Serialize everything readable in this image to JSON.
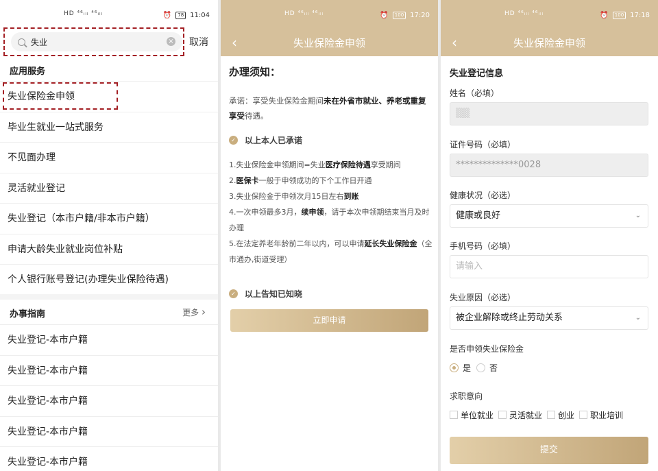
{
  "screen1": {
    "status": {
      "signal": "HD ⁴⁶ᵢₗₗ ⁴⁶ᵢₗₗ",
      "battery": "78",
      "time": "11:04"
    },
    "search": {
      "value": "失业",
      "cancel": "取消"
    },
    "services_title": "应用服务",
    "services": [
      "失业保险金申领",
      "毕业生就业一站式服务",
      "不见面办理",
      "灵活就业登记",
      "失业登记（本市户籍/非本市户籍）",
      "申请大龄失业就业岗位补贴",
      "个人银行账号登记(办理失业保险待遇)"
    ],
    "guide_title": "办事指南",
    "more": "更多",
    "guides": [
      "失业登记-本市户籍",
      "失业登记-本市户籍",
      "失业登记-本市户籍",
      "失业登记-本市户籍",
      "失业登记-本市户籍"
    ]
  },
  "screen2": {
    "status": {
      "signal": "HD ⁴⁶ᵢₗₗ ⁴⁶ᵢₗₗ",
      "battery": "100",
      "time": "17:20"
    },
    "nav_title": "失业保险金申领",
    "notice_title": "办理须知：",
    "promise_a": "承诺：享受失业保险金期间",
    "promise_b": "未在外省市就业、养老或重复享受",
    "promise_c": "待遇。",
    "check1": "以上本人已承诺",
    "rules": [
      {
        "a": "1.失业保险金申领期间=失业",
        "b": "医疗保险待遇",
        "c": "享受期间"
      },
      {
        "a": "2.",
        "b": "医保卡",
        "c": "一般于申领成功的下个工作日开通"
      },
      {
        "a": "3.失业保险金于申领次月15日左右",
        "b": "到账",
        "c": ""
      },
      {
        "a": "4.一次申领最多3月，",
        "b": "续申领",
        "c": "，请于本次申领期结束当月及时办理"
      },
      {
        "a": "5.在法定养老年龄前二年以内，可以申请",
        "b": "延长失业保险金",
        "c": "（全市通办,街道受理）"
      }
    ],
    "check2": "以上告知已知晓",
    "apply": "立即申请"
  },
  "screen3": {
    "status": {
      "signal": "HD ⁴⁶ᵢₗₗ ⁴⁶ᵢₗₗ",
      "battery": "100",
      "time": "17:18"
    },
    "nav_title": "失业保险金申领",
    "form_title": "失业登记信息",
    "name_label": "姓名（必填）",
    "name_value": "▒▒",
    "id_label": "证件号码（必填）",
    "id_value": "**************0028",
    "health_label": "健康状况（必选）",
    "health_value": "健康或良好",
    "phone_label": "手机号码（必填）",
    "phone_placeholder": "请输入",
    "reason_label": "失业原因（必选）",
    "reason_value": "被企业解除或终止劳动关系",
    "claim_label": "是否申领失业保险金",
    "yes": "是",
    "no": "否",
    "intent_label": "求职意向",
    "intents": [
      "单位就业",
      "灵活就业",
      "创业",
      "职业培训"
    ],
    "submit": "提交"
  },
  "colors": {
    "gold": "#d6c09b",
    "highlight": "#a31f24"
  }
}
